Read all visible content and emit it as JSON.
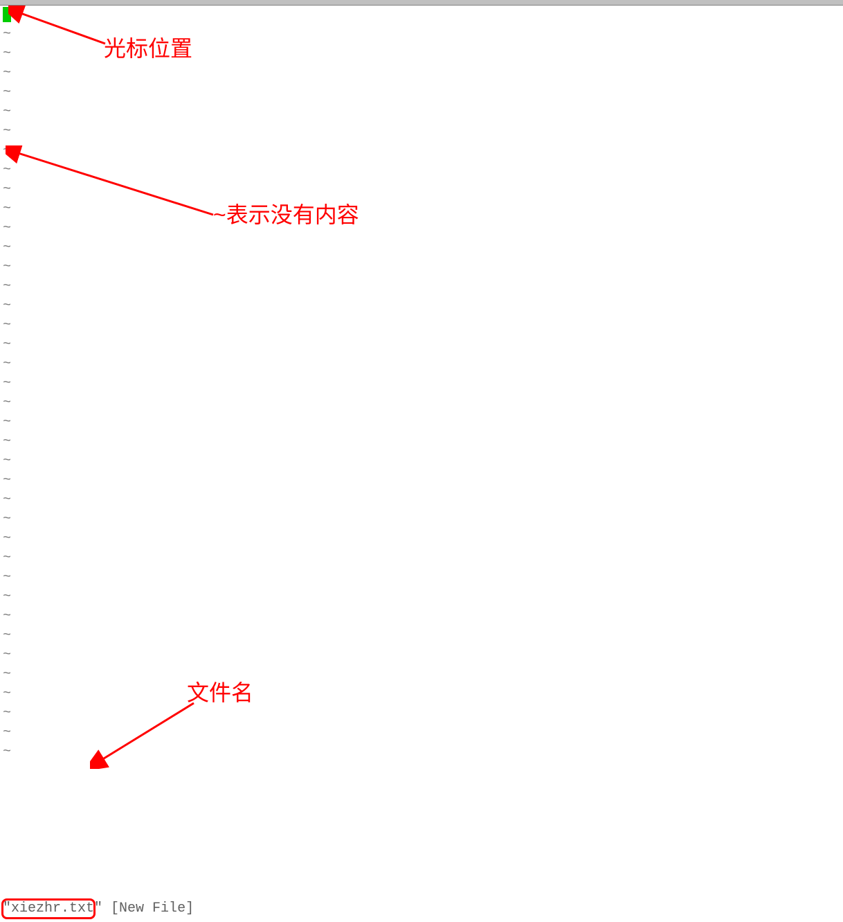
{
  "editor": {
    "tilde_char": "~",
    "tilde_count": 39,
    "status_filename": "\"xiezhr.txt\"",
    "status_newfile": "[New File]"
  },
  "annotations": {
    "cursor_label": "光标位置",
    "tilde_label": "~表示没有内容",
    "filename_label": "文件名"
  }
}
